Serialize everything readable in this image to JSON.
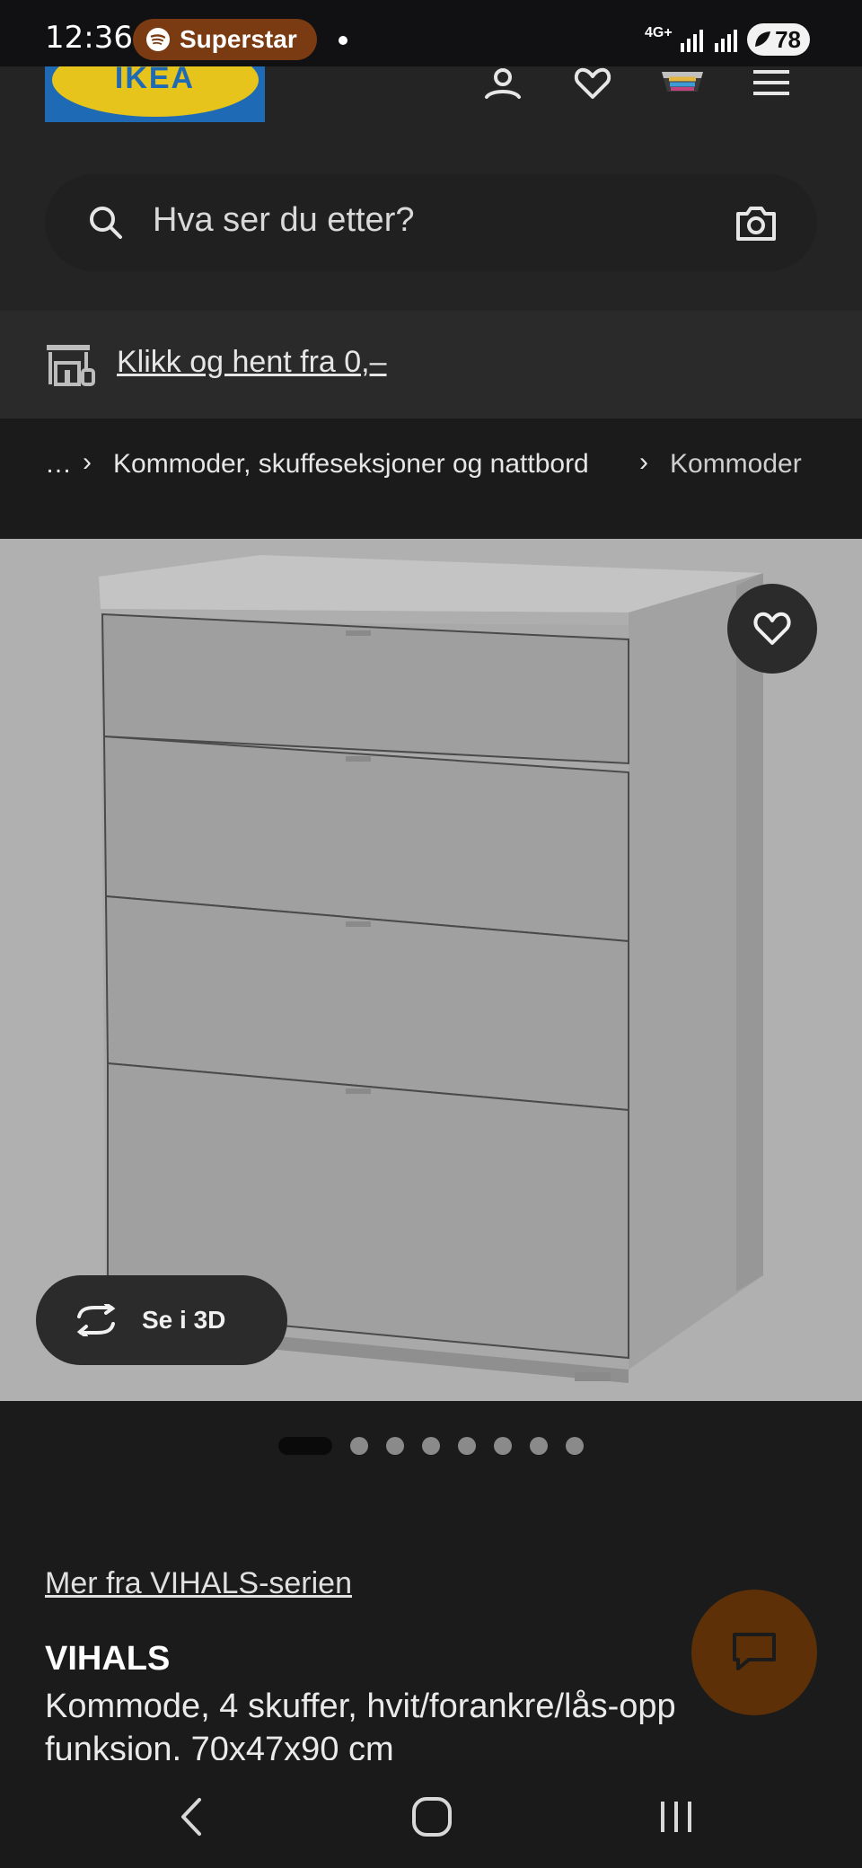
{
  "status_bar": {
    "time": "12:36",
    "media_app": "Superstar",
    "network": "4G+",
    "battery": "78"
  },
  "header": {
    "logo": "IKEA",
    "icons": [
      "user-icon",
      "heart-icon",
      "basket-icon",
      "menu-icon"
    ]
  },
  "search": {
    "placeholder": "Hva ser du etter?"
  },
  "pickup": {
    "link": "Klikk og hent fra 0,–"
  },
  "breadcrumb": {
    "ellipsis": "…",
    "items": [
      "Kommoder, skuffeseksjoner og nattbord",
      "Kommoder"
    ]
  },
  "gallery": {
    "view_3d_label": "Se i 3D",
    "image_count": 8,
    "active_index": 0
  },
  "product": {
    "series_link": "Mer fra VIHALS-serien",
    "name": "VIHALS",
    "description": "Kommode, 4 skuffer, hvit/forankre/lås-opp funksjon, 70x47x90 cm"
  },
  "colors": {
    "background": "#1b1b1c",
    "header": "#242425",
    "accent_pill": "#7a3a12",
    "chat_button": "#5e3007"
  }
}
